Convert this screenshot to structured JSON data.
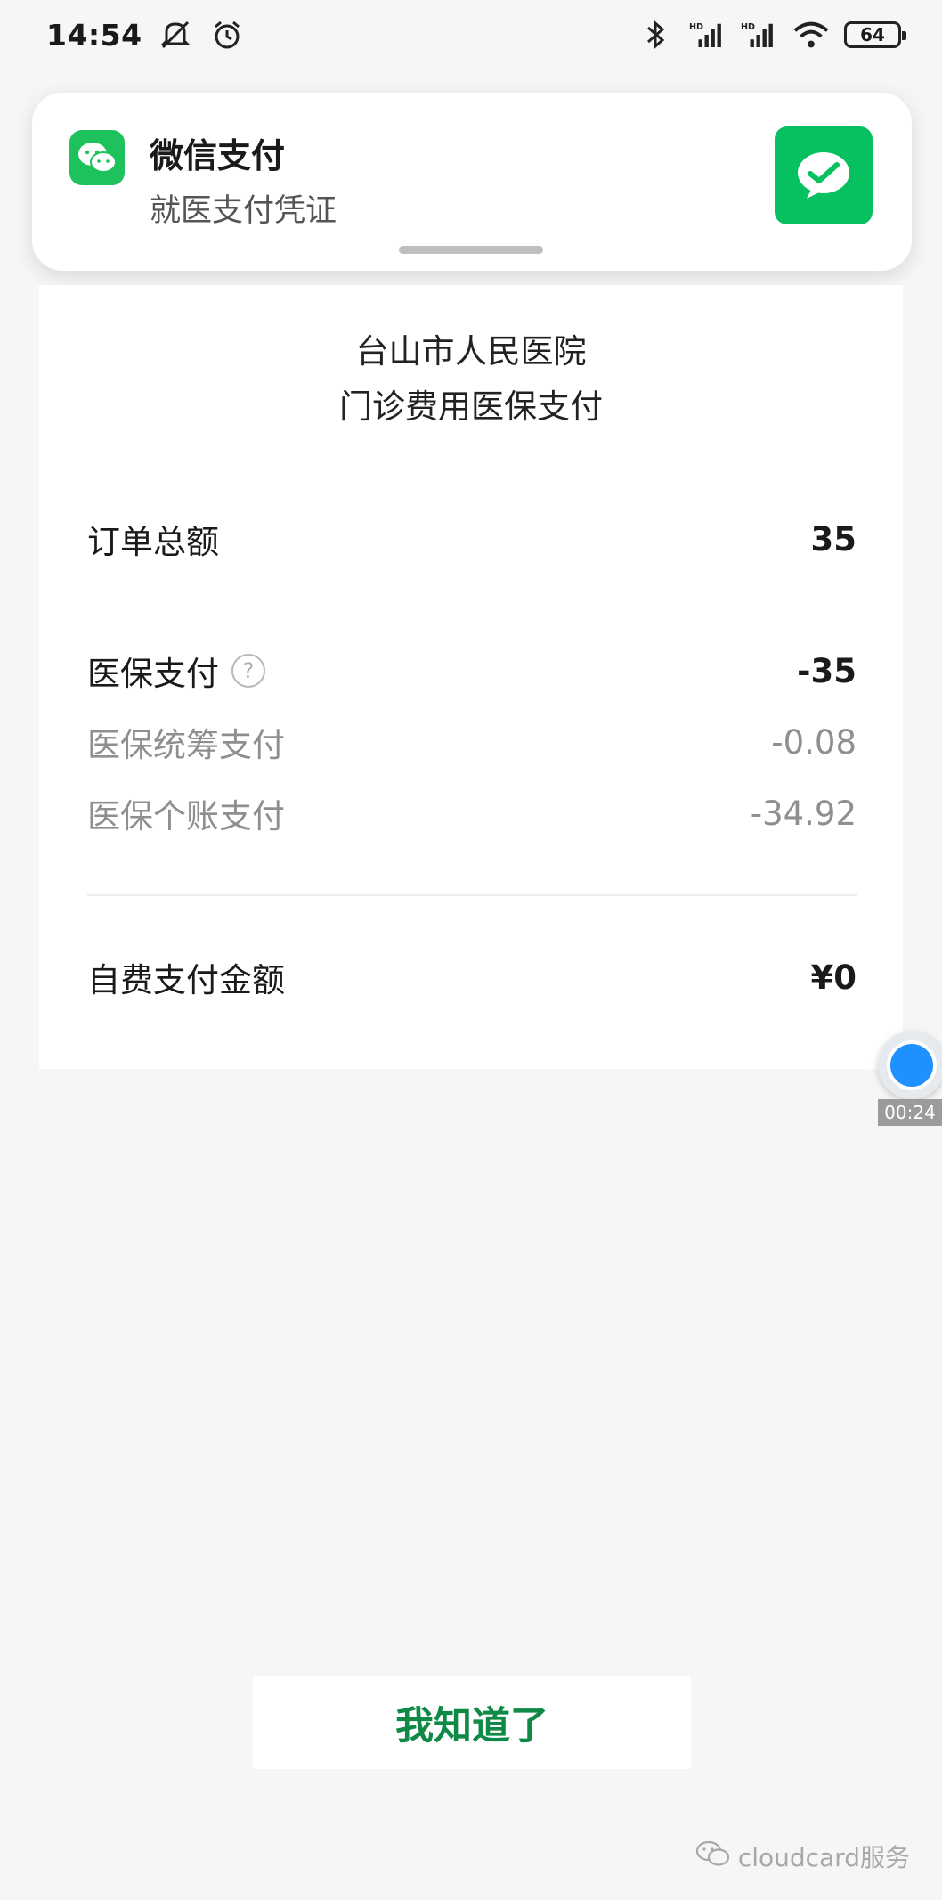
{
  "status_bar": {
    "time": "14:54",
    "battery": "64",
    "icons": [
      "mute-alarm-icon",
      "alarm-icon",
      "bluetooth-icon",
      "signal-hd-icon",
      "signal-hd-icon",
      "wifi-icon",
      "battery-icon"
    ]
  },
  "notification": {
    "app_name": "微信支付",
    "subtitle": "就医支付凭证",
    "accent": "#07c160"
  },
  "receipt": {
    "hospital": "台山市人民医院",
    "payment_type": "门诊费用医保支付",
    "rows": [
      {
        "label": "订单总额",
        "value": "35"
      },
      {
        "label": "医保支付",
        "value": "-35"
      },
      {
        "label": "医保统筹支付",
        "value": "-0.08"
      },
      {
        "label": "医保个账支付",
        "value": "-34.92"
      },
      {
        "label": "自费支付金额",
        "value": "¥0"
      }
    ],
    "help_glyph": "?"
  },
  "recorder": {
    "time": "00:24"
  },
  "confirm_button": {
    "label": "我知道了",
    "color": "#0f8a46"
  },
  "watermark": {
    "text": "cloudcard服务"
  }
}
